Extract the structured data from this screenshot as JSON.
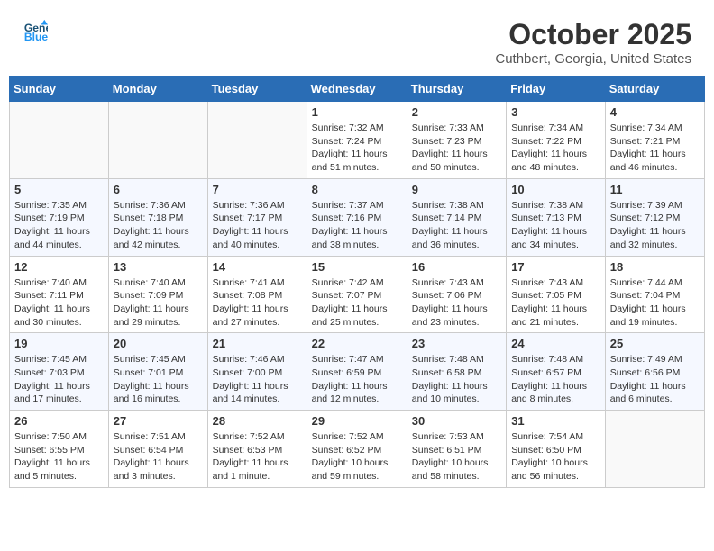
{
  "header": {
    "logo_line1": "General",
    "logo_line2": "Blue",
    "month": "October 2025",
    "location": "Cuthbert, Georgia, United States"
  },
  "days_of_week": [
    "Sunday",
    "Monday",
    "Tuesday",
    "Wednesday",
    "Thursday",
    "Friday",
    "Saturday"
  ],
  "weeks": [
    [
      {
        "num": "",
        "sunrise": "",
        "sunset": "",
        "daylight": ""
      },
      {
        "num": "",
        "sunrise": "",
        "sunset": "",
        "daylight": ""
      },
      {
        "num": "",
        "sunrise": "",
        "sunset": "",
        "daylight": ""
      },
      {
        "num": "1",
        "sunrise": "Sunrise: 7:32 AM",
        "sunset": "Sunset: 7:24 PM",
        "daylight": "Daylight: 11 hours and 51 minutes."
      },
      {
        "num": "2",
        "sunrise": "Sunrise: 7:33 AM",
        "sunset": "Sunset: 7:23 PM",
        "daylight": "Daylight: 11 hours and 50 minutes."
      },
      {
        "num": "3",
        "sunrise": "Sunrise: 7:34 AM",
        "sunset": "Sunset: 7:22 PM",
        "daylight": "Daylight: 11 hours and 48 minutes."
      },
      {
        "num": "4",
        "sunrise": "Sunrise: 7:34 AM",
        "sunset": "Sunset: 7:21 PM",
        "daylight": "Daylight: 11 hours and 46 minutes."
      }
    ],
    [
      {
        "num": "5",
        "sunrise": "Sunrise: 7:35 AM",
        "sunset": "Sunset: 7:19 PM",
        "daylight": "Daylight: 11 hours and 44 minutes."
      },
      {
        "num": "6",
        "sunrise": "Sunrise: 7:36 AM",
        "sunset": "Sunset: 7:18 PM",
        "daylight": "Daylight: 11 hours and 42 minutes."
      },
      {
        "num": "7",
        "sunrise": "Sunrise: 7:36 AM",
        "sunset": "Sunset: 7:17 PM",
        "daylight": "Daylight: 11 hours and 40 minutes."
      },
      {
        "num": "8",
        "sunrise": "Sunrise: 7:37 AM",
        "sunset": "Sunset: 7:16 PM",
        "daylight": "Daylight: 11 hours and 38 minutes."
      },
      {
        "num": "9",
        "sunrise": "Sunrise: 7:38 AM",
        "sunset": "Sunset: 7:14 PM",
        "daylight": "Daylight: 11 hours and 36 minutes."
      },
      {
        "num": "10",
        "sunrise": "Sunrise: 7:38 AM",
        "sunset": "Sunset: 7:13 PM",
        "daylight": "Daylight: 11 hours and 34 minutes."
      },
      {
        "num": "11",
        "sunrise": "Sunrise: 7:39 AM",
        "sunset": "Sunset: 7:12 PM",
        "daylight": "Daylight: 11 hours and 32 minutes."
      }
    ],
    [
      {
        "num": "12",
        "sunrise": "Sunrise: 7:40 AM",
        "sunset": "Sunset: 7:11 PM",
        "daylight": "Daylight: 11 hours and 30 minutes."
      },
      {
        "num": "13",
        "sunrise": "Sunrise: 7:40 AM",
        "sunset": "Sunset: 7:09 PM",
        "daylight": "Daylight: 11 hours and 29 minutes."
      },
      {
        "num": "14",
        "sunrise": "Sunrise: 7:41 AM",
        "sunset": "Sunset: 7:08 PM",
        "daylight": "Daylight: 11 hours and 27 minutes."
      },
      {
        "num": "15",
        "sunrise": "Sunrise: 7:42 AM",
        "sunset": "Sunset: 7:07 PM",
        "daylight": "Daylight: 11 hours and 25 minutes."
      },
      {
        "num": "16",
        "sunrise": "Sunrise: 7:43 AM",
        "sunset": "Sunset: 7:06 PM",
        "daylight": "Daylight: 11 hours and 23 minutes."
      },
      {
        "num": "17",
        "sunrise": "Sunrise: 7:43 AM",
        "sunset": "Sunset: 7:05 PM",
        "daylight": "Daylight: 11 hours and 21 minutes."
      },
      {
        "num": "18",
        "sunrise": "Sunrise: 7:44 AM",
        "sunset": "Sunset: 7:04 PM",
        "daylight": "Daylight: 11 hours and 19 minutes."
      }
    ],
    [
      {
        "num": "19",
        "sunrise": "Sunrise: 7:45 AM",
        "sunset": "Sunset: 7:03 PM",
        "daylight": "Daylight: 11 hours and 17 minutes."
      },
      {
        "num": "20",
        "sunrise": "Sunrise: 7:45 AM",
        "sunset": "Sunset: 7:01 PM",
        "daylight": "Daylight: 11 hours and 16 minutes."
      },
      {
        "num": "21",
        "sunrise": "Sunrise: 7:46 AM",
        "sunset": "Sunset: 7:00 PM",
        "daylight": "Daylight: 11 hours and 14 minutes."
      },
      {
        "num": "22",
        "sunrise": "Sunrise: 7:47 AM",
        "sunset": "Sunset: 6:59 PM",
        "daylight": "Daylight: 11 hours and 12 minutes."
      },
      {
        "num": "23",
        "sunrise": "Sunrise: 7:48 AM",
        "sunset": "Sunset: 6:58 PM",
        "daylight": "Daylight: 11 hours and 10 minutes."
      },
      {
        "num": "24",
        "sunrise": "Sunrise: 7:48 AM",
        "sunset": "Sunset: 6:57 PM",
        "daylight": "Daylight: 11 hours and 8 minutes."
      },
      {
        "num": "25",
        "sunrise": "Sunrise: 7:49 AM",
        "sunset": "Sunset: 6:56 PM",
        "daylight": "Daylight: 11 hours and 6 minutes."
      }
    ],
    [
      {
        "num": "26",
        "sunrise": "Sunrise: 7:50 AM",
        "sunset": "Sunset: 6:55 PM",
        "daylight": "Daylight: 11 hours and 5 minutes."
      },
      {
        "num": "27",
        "sunrise": "Sunrise: 7:51 AM",
        "sunset": "Sunset: 6:54 PM",
        "daylight": "Daylight: 11 hours and 3 minutes."
      },
      {
        "num": "28",
        "sunrise": "Sunrise: 7:52 AM",
        "sunset": "Sunset: 6:53 PM",
        "daylight": "Daylight: 11 hours and 1 minute."
      },
      {
        "num": "29",
        "sunrise": "Sunrise: 7:52 AM",
        "sunset": "Sunset: 6:52 PM",
        "daylight": "Daylight: 10 hours and 59 minutes."
      },
      {
        "num": "30",
        "sunrise": "Sunrise: 7:53 AM",
        "sunset": "Sunset: 6:51 PM",
        "daylight": "Daylight: 10 hours and 58 minutes."
      },
      {
        "num": "31",
        "sunrise": "Sunrise: 7:54 AM",
        "sunset": "Sunset: 6:50 PM",
        "daylight": "Daylight: 10 hours and 56 minutes."
      },
      {
        "num": "",
        "sunrise": "",
        "sunset": "",
        "daylight": ""
      }
    ]
  ]
}
